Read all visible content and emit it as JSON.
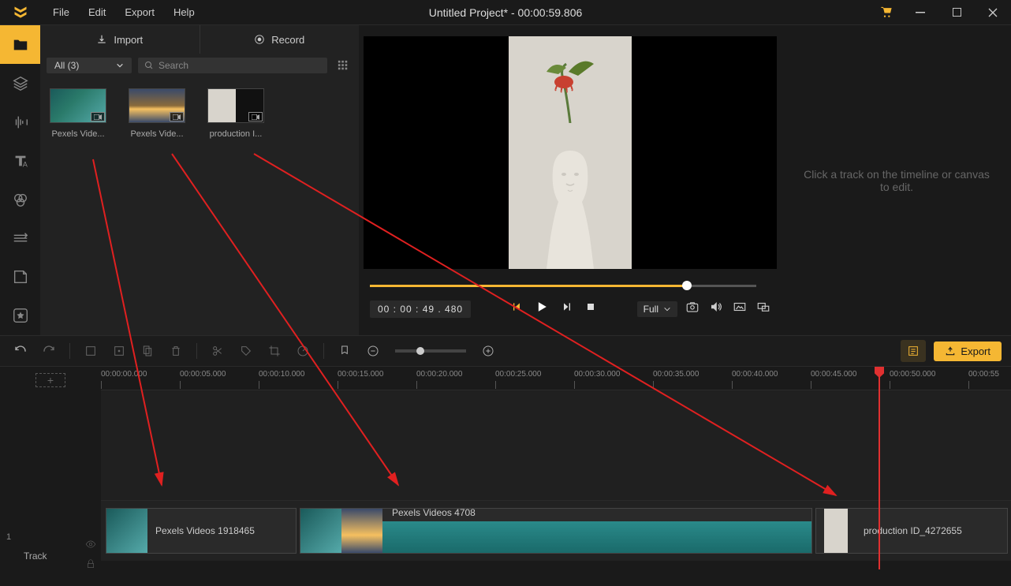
{
  "title": "Untitled Project* - 00:00:59.806",
  "menus": [
    "File",
    "Edit",
    "Export",
    "Help"
  ],
  "media": {
    "import_label": "Import",
    "record_label": "Record",
    "filter": "All (3)",
    "search_placeholder": "Search",
    "items": [
      {
        "label": "Pexels Vide..."
      },
      {
        "label": "Pexels Vide..."
      },
      {
        "label": "production I..."
      }
    ]
  },
  "preview": {
    "timecode": "00 : 00 : 49 . 480",
    "size_label": "Full"
  },
  "right_help": "Click a track on the timeline or canvas to edit.",
  "toolbar": {
    "export_label": "Export"
  },
  "timeline": {
    "ticks": [
      "00:00:00.000",
      "00:00:05.000",
      "00:00:10.000",
      "00:00:15.000",
      "00:00:20.000",
      "00:00:25.000",
      "00:00:30.000",
      "00:00:35.000",
      "00:00:40.000",
      "00:00:45.000",
      "00:00:50.000",
      "00:00:55"
    ],
    "track_num": "1",
    "track_label": "Track",
    "clips": [
      {
        "label": "Pexels Videos 1918465"
      },
      {
        "label": "Pexels Videos 4708"
      },
      {
        "label": "production ID_4272655"
      }
    ]
  }
}
